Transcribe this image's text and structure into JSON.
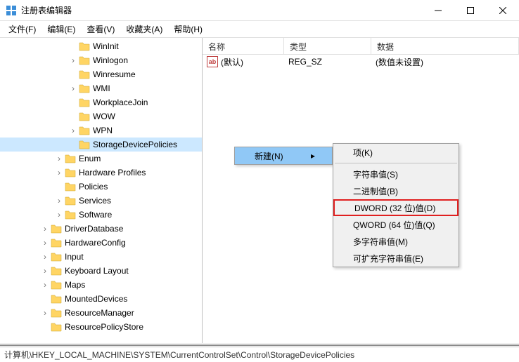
{
  "title": "注册表编辑器",
  "menubar": [
    "文件(F)",
    "编辑(E)",
    "查看(V)",
    "收藏夹(A)",
    "帮助(H)"
  ],
  "tree": [
    {
      "label": "WinInit",
      "indent": 96,
      "expander": ""
    },
    {
      "label": "Winlogon",
      "indent": 96,
      "expander": "›"
    },
    {
      "label": "Winresume",
      "indent": 96,
      "expander": ""
    },
    {
      "label": "WMI",
      "indent": 96,
      "expander": "›"
    },
    {
      "label": "WorkplaceJoin",
      "indent": 96,
      "expander": ""
    },
    {
      "label": "WOW",
      "indent": 96,
      "expander": ""
    },
    {
      "label": "WPN",
      "indent": 96,
      "expander": "›"
    },
    {
      "label": "StorageDevicePolicies",
      "indent": 96,
      "expander": "",
      "selected": true
    },
    {
      "label": "Enum",
      "indent": 76,
      "expander": "›"
    },
    {
      "label": "Hardware Profiles",
      "indent": 76,
      "expander": "›"
    },
    {
      "label": "Policies",
      "indent": 76,
      "expander": ""
    },
    {
      "label": "Services",
      "indent": 76,
      "expander": "›"
    },
    {
      "label": "Software",
      "indent": 76,
      "expander": "›"
    },
    {
      "label": "DriverDatabase",
      "indent": 56,
      "expander": "›"
    },
    {
      "label": "HardwareConfig",
      "indent": 56,
      "expander": "›"
    },
    {
      "label": "Input",
      "indent": 56,
      "expander": "›"
    },
    {
      "label": "Keyboard Layout",
      "indent": 56,
      "expander": "›"
    },
    {
      "label": "Maps",
      "indent": 56,
      "expander": "›"
    },
    {
      "label": "MountedDevices",
      "indent": 56,
      "expander": ""
    },
    {
      "label": "ResourceManager",
      "indent": 56,
      "expander": "›"
    },
    {
      "label": "ResourcePolicyStore",
      "indent": 56,
      "expander": ""
    }
  ],
  "columns": {
    "name": "名称",
    "type": "类型",
    "data": "数据"
  },
  "rows": [
    {
      "icon": "ab",
      "name": "(默认)",
      "type": "REG_SZ",
      "data": "(数值未设置)"
    }
  ],
  "context_primary": {
    "label": "新建(N)"
  },
  "context_secondary": [
    {
      "label": "项(K)"
    },
    {
      "label": "字符串值(S)"
    },
    {
      "label": "二进制值(B)"
    },
    {
      "label": "DWORD (32 位)值(D)",
      "highlighted": true
    },
    {
      "label": "QWORD (64 位)值(Q)"
    },
    {
      "label": "多字符串值(M)"
    },
    {
      "label": "可扩充字符串值(E)"
    }
  ],
  "statusbar": "计算机\\HKEY_LOCAL_MACHINE\\SYSTEM\\CurrentControlSet\\Control\\StorageDevicePolicies"
}
